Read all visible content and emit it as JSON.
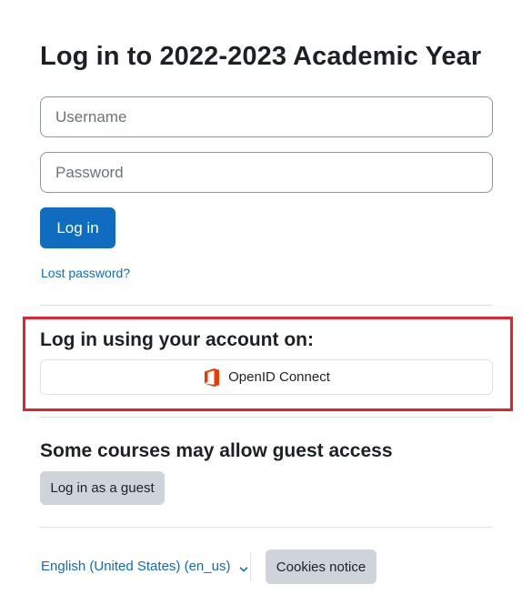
{
  "login": {
    "title": "Log in to 2022-2023 Academic Year",
    "username_placeholder": "Username",
    "password_placeholder": "Password",
    "submit_label": "Log in",
    "lost_password": "Lost password?"
  },
  "sso": {
    "heading": "Log in using your account on:",
    "provider_label": "OpenID Connect",
    "provider_icon": "office-icon",
    "highlight_color": "#e8212e"
  },
  "guest": {
    "heading": "Some courses may allow guest access",
    "button_label": "Log in as a guest"
  },
  "footer": {
    "language": "English (United States) (en_us)",
    "language_icon": "chevron-down-icon",
    "cookies_label": "Cookies notice"
  },
  "colors": {
    "primary": "#0f6cbf",
    "secondary_button": "#ced4da",
    "text": "#1d2125"
  }
}
